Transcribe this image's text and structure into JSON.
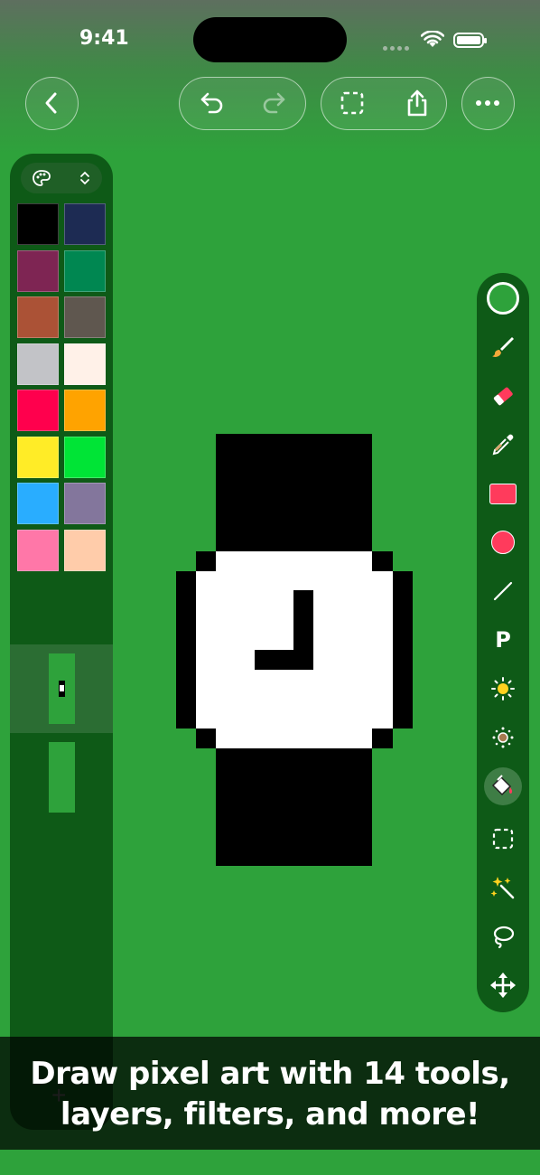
{
  "status_bar": {
    "time": "9:41"
  },
  "toolbar": {
    "back_icon": "chevron-left-icon",
    "undo_icon": "undo-icon",
    "redo_icon": "redo-icon",
    "select_icon": "selection-icon",
    "share_icon": "share-icon",
    "more_icon": "ellipsis-icon"
  },
  "palette": {
    "icon": "palette-icon",
    "colors": [
      "#000000",
      "#1d2b53",
      "#7e2553",
      "#008751",
      "#ab5236",
      "#5f574f",
      "#c2c3c7",
      "#fff1e8",
      "#ff004d",
      "#ffa300",
      "#ffec27",
      "#00e436",
      "#29adff",
      "#83769c",
      "#ff77a8",
      "#ffccaa"
    ]
  },
  "layers": {
    "count": 2,
    "selected": 0
  },
  "tools": [
    {
      "name": "color-picker-swatch"
    },
    {
      "name": "brush-icon"
    },
    {
      "name": "eraser-icon"
    },
    {
      "name": "eyedropper-icon"
    },
    {
      "name": "rectangle-icon"
    },
    {
      "name": "circle-icon"
    },
    {
      "name": "line-icon"
    },
    {
      "name": "text-tool",
      "label": "P"
    },
    {
      "name": "brighten-icon"
    },
    {
      "name": "darken-icon"
    },
    {
      "name": "fill-bucket-icon",
      "selected": true
    },
    {
      "name": "marquee-select-icon"
    },
    {
      "name": "magic-wand-icon"
    },
    {
      "name": "lasso-icon"
    },
    {
      "name": "move-icon"
    }
  ],
  "canvas": {
    "background": "#2ea23b",
    "subject": "watch"
  },
  "banner": {
    "line1": "Draw pixel art with 14 tools,",
    "line2": "layers, filters, and more!"
  }
}
